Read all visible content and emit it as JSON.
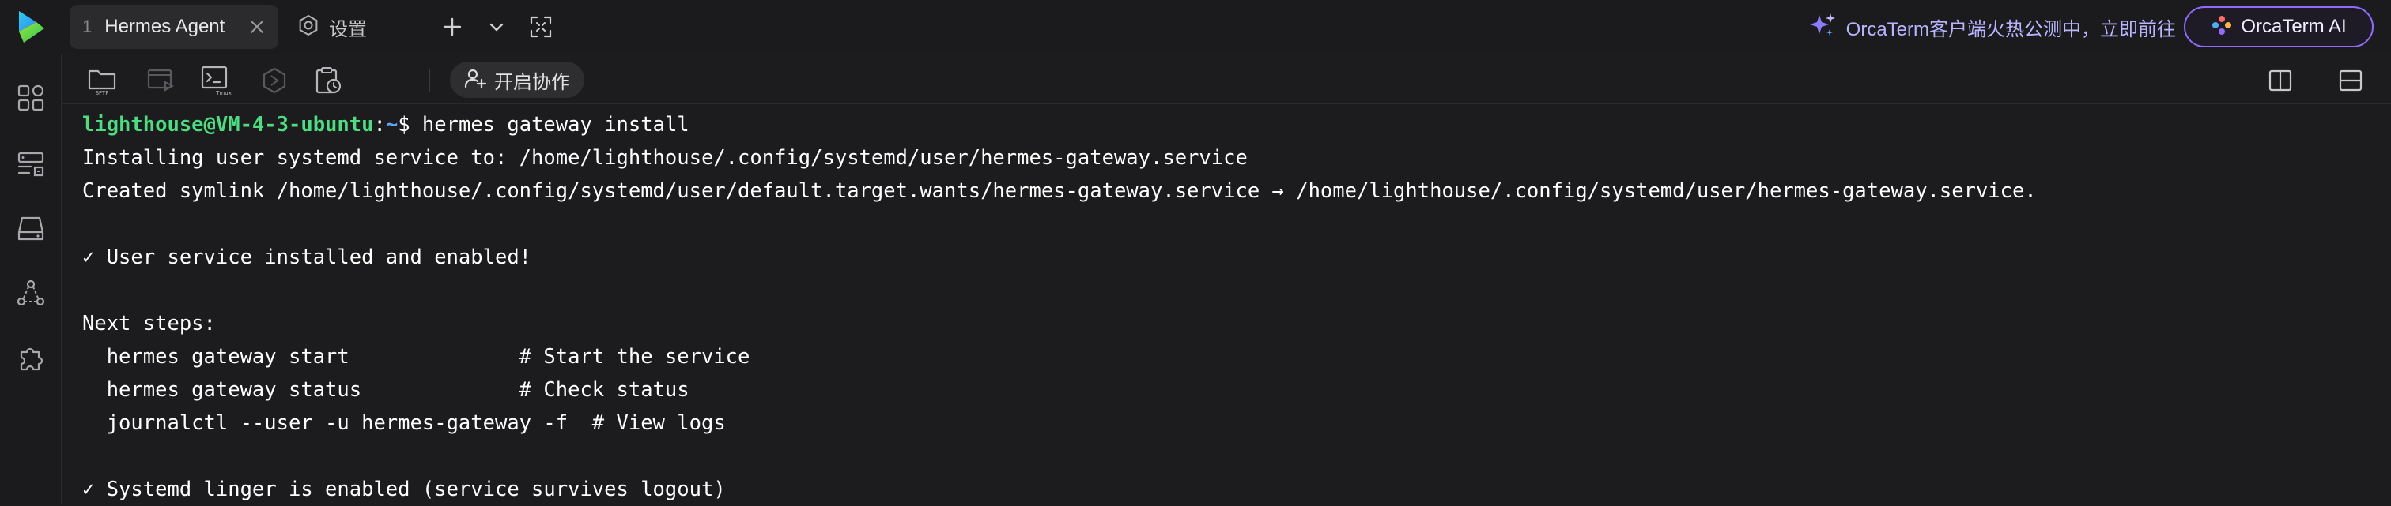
{
  "tabs": [
    {
      "number": "1",
      "title": "Hermes Agent",
      "active": true
    },
    {
      "title": "设置",
      "active": false
    }
  ],
  "promo": {
    "text": "OrcaTerm客户端火热公测中，立即前往"
  },
  "ai_button": {
    "label": "OrcaTerm AI"
  },
  "toolbar": {
    "sftp_label": "SFTP",
    "tmux_label": "Tmux",
    "collab_label": "开启协作"
  },
  "terminal": {
    "prompt": {
      "user_host": "lighthouse@VM-4-3-ubuntu",
      "separator": ":",
      "path": "~",
      "symbol": "$ "
    },
    "command": "hermes gateway install",
    "lines": [
      "Installing user systemd service to: /home/lighthouse/.config/systemd/user/hermes-gateway.service",
      "Created symlink /home/lighthouse/.config/systemd/user/default.target.wants/hermes-gateway.service → /home/lighthouse/.config/systemd/user/hermes-gateway.service.",
      "",
      "✓ User service installed and enabled!",
      "",
      "Next steps:",
      "  hermes gateway start              # Start the service",
      "  hermes gateway status             # Check status",
      "  journalctl --user -u hermes-gateway -f  # View logs",
      "",
      "✓ Systemd linger is enabled (service survives logout)"
    ]
  },
  "colors": {
    "background": "#1c1c1e",
    "prompt_user": "#4ade80",
    "prompt_path": "#60a5fa",
    "accent_purple": "#8f6bff"
  }
}
